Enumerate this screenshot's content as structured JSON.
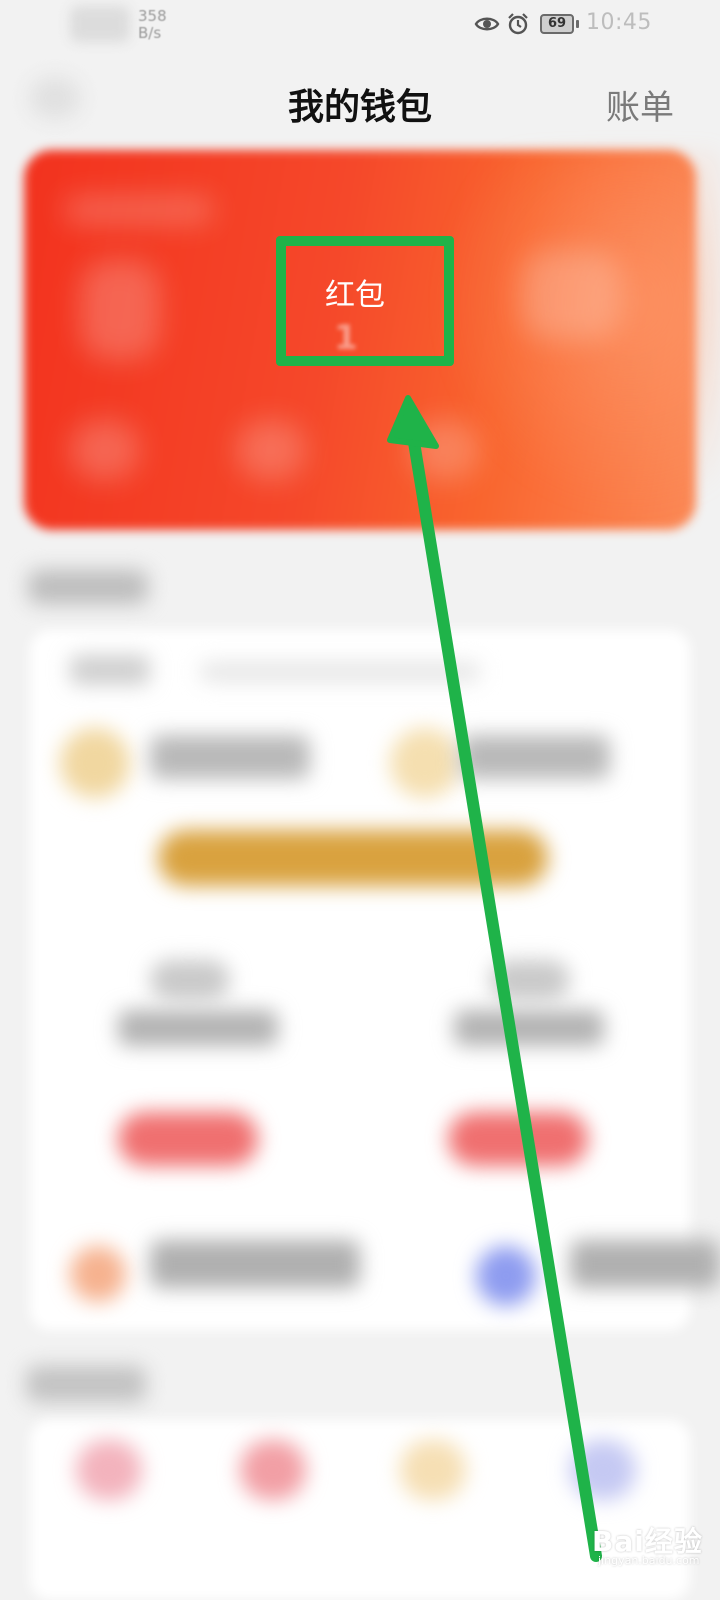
{
  "status_bar": {
    "speed_value": "358",
    "speed_unit": "B/s",
    "battery": "69",
    "time": "10:45"
  },
  "header": {
    "title": "我的钱包",
    "bill_link": "账单"
  },
  "wallet_card": {
    "focused_item_label": "红包",
    "focused_item_count": "1"
  },
  "watermark": {
    "text": "Bai经验",
    "sub": "jingyan.baidu.com"
  },
  "colors": {
    "highlight": "#1fb349",
    "card_red": "#f2321e",
    "card_orange": "#fb8a57"
  }
}
